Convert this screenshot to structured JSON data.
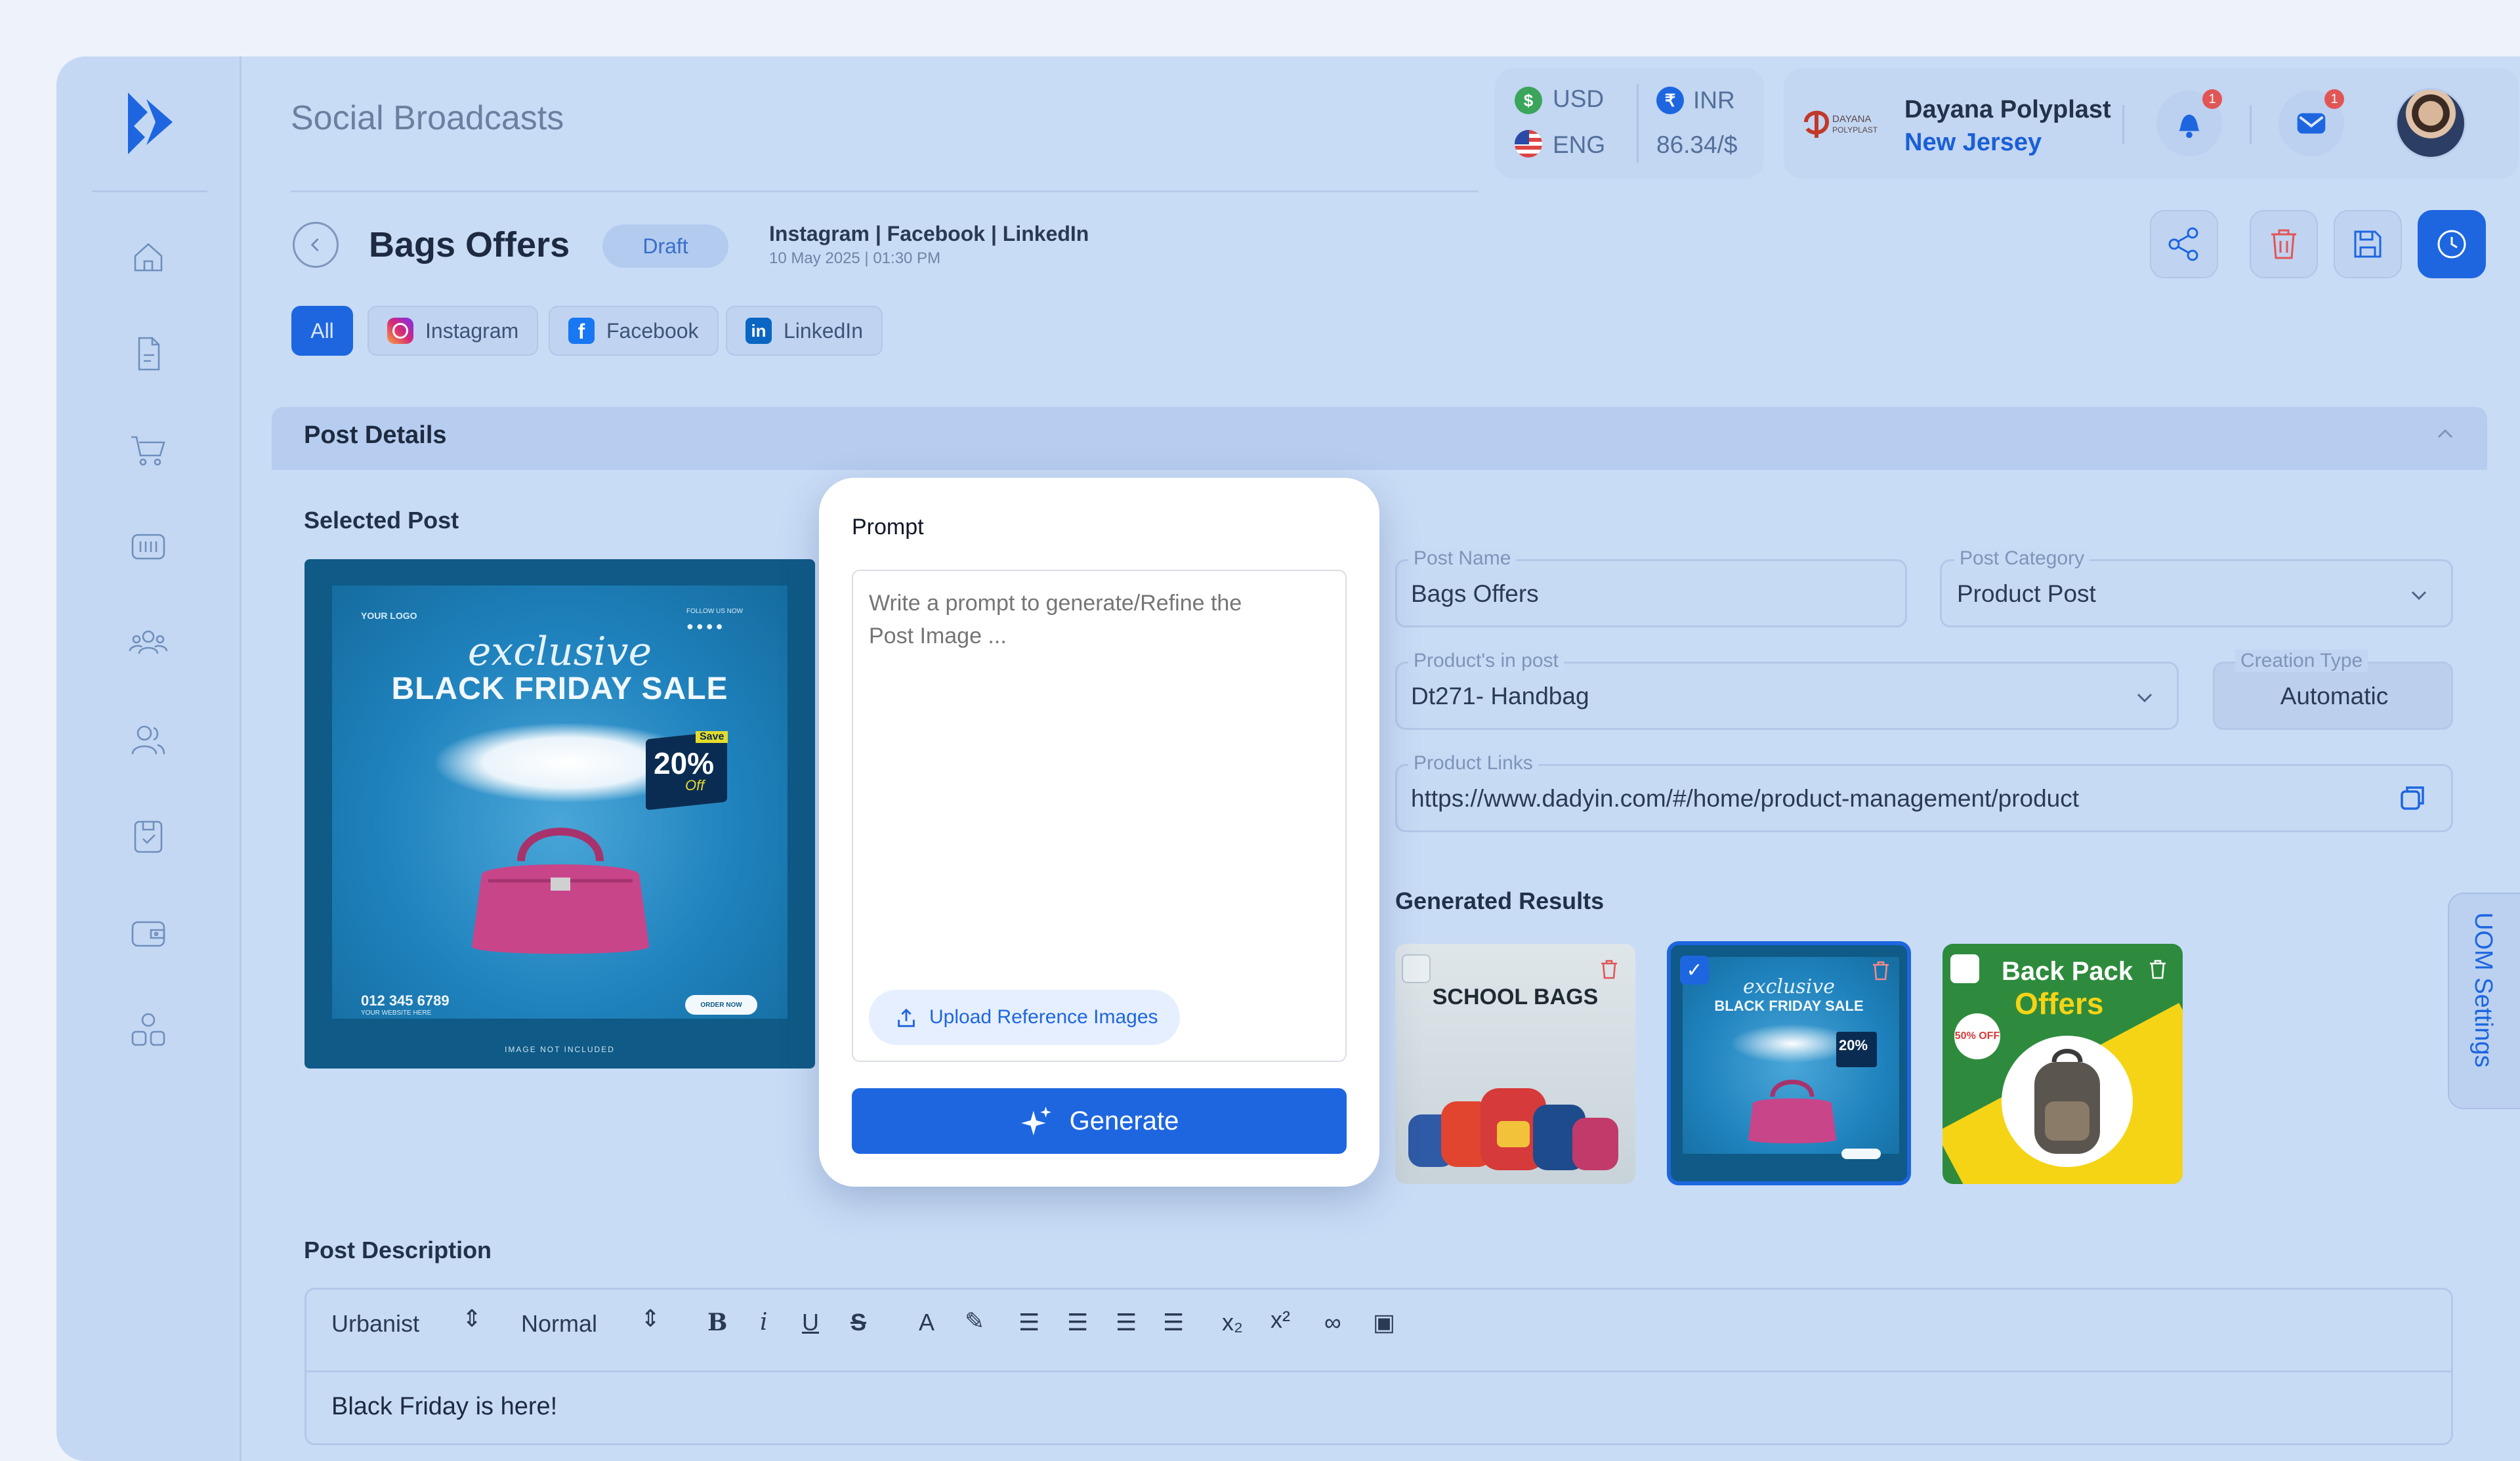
{
  "app": {
    "title": "Social Broadcasts"
  },
  "currency": {
    "usd": "USD",
    "eng": "ENG",
    "inr": "INR",
    "rate": "86.34/$"
  },
  "company": {
    "name": "Dayana Polyplast",
    "location": "New Jersey",
    "logo_text": "DAYANA POLYPLAST"
  },
  "notifications": {
    "bell_count": "1",
    "mail_count": "1"
  },
  "post": {
    "title": "Bags Offers",
    "status": "Draft",
    "platforms": "Instagram | Facebook | LinkedIn",
    "date": "10 May 2025 | 01:30 PM"
  },
  "filters": [
    "All",
    "Instagram",
    "Facebook",
    "LinkedIn"
  ],
  "section": {
    "title": "Post Details"
  },
  "selected": {
    "label": "Selected Post",
    "image": {
      "brand": "YOUR LOGO",
      "follow": "FOLLOW US NOW",
      "script": "exclusive",
      "headline": "BLACK FRIDAY SALE",
      "save": "Save",
      "percent": "20%",
      "off": "Off",
      "phone": "012 345 6789",
      "website": "YOUR WEBSITE HERE",
      "order": "ORDER NOW",
      "footer": "IMAGE NOT INCLUDED"
    }
  },
  "prompt": {
    "title": "Prompt",
    "placeholder": "Write a prompt to generate/Refine the Post Image ...",
    "upload_label": "Upload Reference Images",
    "generate_label": "Generate"
  },
  "form": {
    "post_name_label": "Post Name",
    "post_name_value": "Bags Offers",
    "post_category_label": "Post Category",
    "post_category_value": "Product Post",
    "products_label": "Product's in post",
    "products_value": "Dt271- Handbag",
    "creation_type_label": "Creation Type",
    "creation_type_value": "Automatic",
    "product_links_label": "Product Links",
    "product_links_value": "https://www.dadyin.com/#/home/product-management/product"
  },
  "results": {
    "label": "Generated Results",
    "items": [
      {
        "title": "SCHOOL BAGS",
        "selected": false
      },
      {
        "title": "BLACK FRIDAY SALE",
        "script": "exclusive",
        "percent": "20%",
        "selected": true
      },
      {
        "title": "Back Pack",
        "subtitle": "Offers",
        "discount": "50% OFF",
        "selected": false
      }
    ]
  },
  "uom": {
    "label": "UOM Settings"
  },
  "description": {
    "label": "Post Description",
    "font": "Urbanist",
    "size": "Normal",
    "text": "Black Friday is here!"
  },
  "colors": {
    "primary": "#1e66e0",
    "danger": "#e25555",
    "frame": "#c9dcf6",
    "green": "#2e8b3d",
    "yellow": "#f5d416"
  }
}
